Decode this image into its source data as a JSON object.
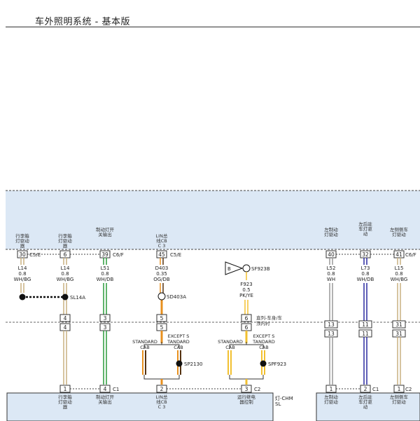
{
  "page": {
    "title": "车外照明系统 - 基本版"
  },
  "top_module": {
    "pins": [
      {
        "id": "p1",
        "label": "行李箱\n灯驱动\n器",
        "pin": "30",
        "conn": "C5/E"
      },
      {
        "id": "p2",
        "label": "行李箱\n灯驱动\n器",
        "pin": "6",
        "conn": ""
      },
      {
        "id": "p3",
        "label": "制动灯开\n关输出",
        "pin": "39",
        "conn": "C6/F"
      },
      {
        "id": "p4",
        "label": "LIN总\n线CB\nC 3",
        "pin": "45",
        "conn": "C5/E"
      },
      {
        "id": "p5",
        "label": "左制动\n灯驱动",
        "pin": "40",
        "conn": ""
      },
      {
        "id": "p6",
        "label": "左后驻\n车灯驱\n动",
        "pin": "32",
        "conn": ""
      },
      {
        "id": "p7",
        "label": "左侧侧车\n灯驱动",
        "pin": "41",
        "conn": "C6/F"
      }
    ]
  },
  "wires": [
    {
      "id": "w1",
      "circuit": "L14",
      "gauge": "0.8",
      "color": "WH/BG"
    },
    {
      "id": "w2",
      "circuit": "L14",
      "gauge": "0.8",
      "color": "WH/BG"
    },
    {
      "id": "w3",
      "circuit": "L51",
      "gauge": "0.8",
      "color": "WH/DB"
    },
    {
      "id": "w4",
      "circuit": "D403",
      "gauge": "0.35",
      "color": "OG/DB"
    },
    {
      "id": "w5",
      "circuit": "F923",
      "gauge": "0.5",
      "color": "PK/YE"
    },
    {
      "id": "w6",
      "circuit": "L52",
      "gauge": "0.8",
      "color": "WH"
    },
    {
      "id": "w7",
      "circuit": "L73",
      "gauge": "0.8",
      "color": "WH/DB"
    },
    {
      "id": "w8",
      "circuit": "L15",
      "gauge": "0.8",
      "color": "WH/BG"
    }
  ],
  "splices": {
    "sl14a": "SL14A",
    "sd403a": "SD403A",
    "sf923b": "SF923B",
    "sp2130": "SP2130",
    "spf923": "SPF923"
  },
  "connector_b": "B",
  "inline_connector": {
    "label": "直列-车身/车\n顶内衬",
    "pins_left": [
      "4",
      "3",
      "5",
      "6"
    ],
    "pins_right": [
      "13",
      "11",
      "31"
    ]
  },
  "variants": {
    "standard": "STANDARD\nCAB",
    "except": "EXCEPT S\nTANDARD\nCAB"
  },
  "bottom_module": {
    "pins": [
      {
        "id": "b1",
        "pin": "1",
        "conn": "",
        "label": "行李箱\n灯驱动\n器"
      },
      {
        "id": "b2",
        "pin": "4",
        "conn": "C1",
        "label": "制动灯开\n关输出"
      },
      {
        "id": "b3",
        "pin": "2",
        "conn": "",
        "label": "LIN总\n线CB\nC 3"
      },
      {
        "id": "b4",
        "pin": "3",
        "conn": "C2",
        "label": "运行继电\n器控制"
      },
      {
        "id": "b5",
        "pin": "1",
        "conn": "",
        "label": "左制动\n灯驱动"
      },
      {
        "id": "b6",
        "pin": "2",
        "conn": "C1",
        "label": "左后驻\n车灯驱\n动"
      },
      {
        "id": "b7",
        "pin": "1",
        "conn": "C2",
        "label": "左侧侧车\n灯驱动"
      }
    ],
    "name": "灯-CHM\nSL"
  },
  "colors": {
    "module_fill": "#dce8f5",
    "wire_green": "#2a9a3a",
    "wire_orange": "#e8901e",
    "wire_yellow": "#f2c030",
    "wire_blue": "#2a2aa0",
    "wire_tan": "#c8b080",
    "wire_dark": "#553311"
  }
}
